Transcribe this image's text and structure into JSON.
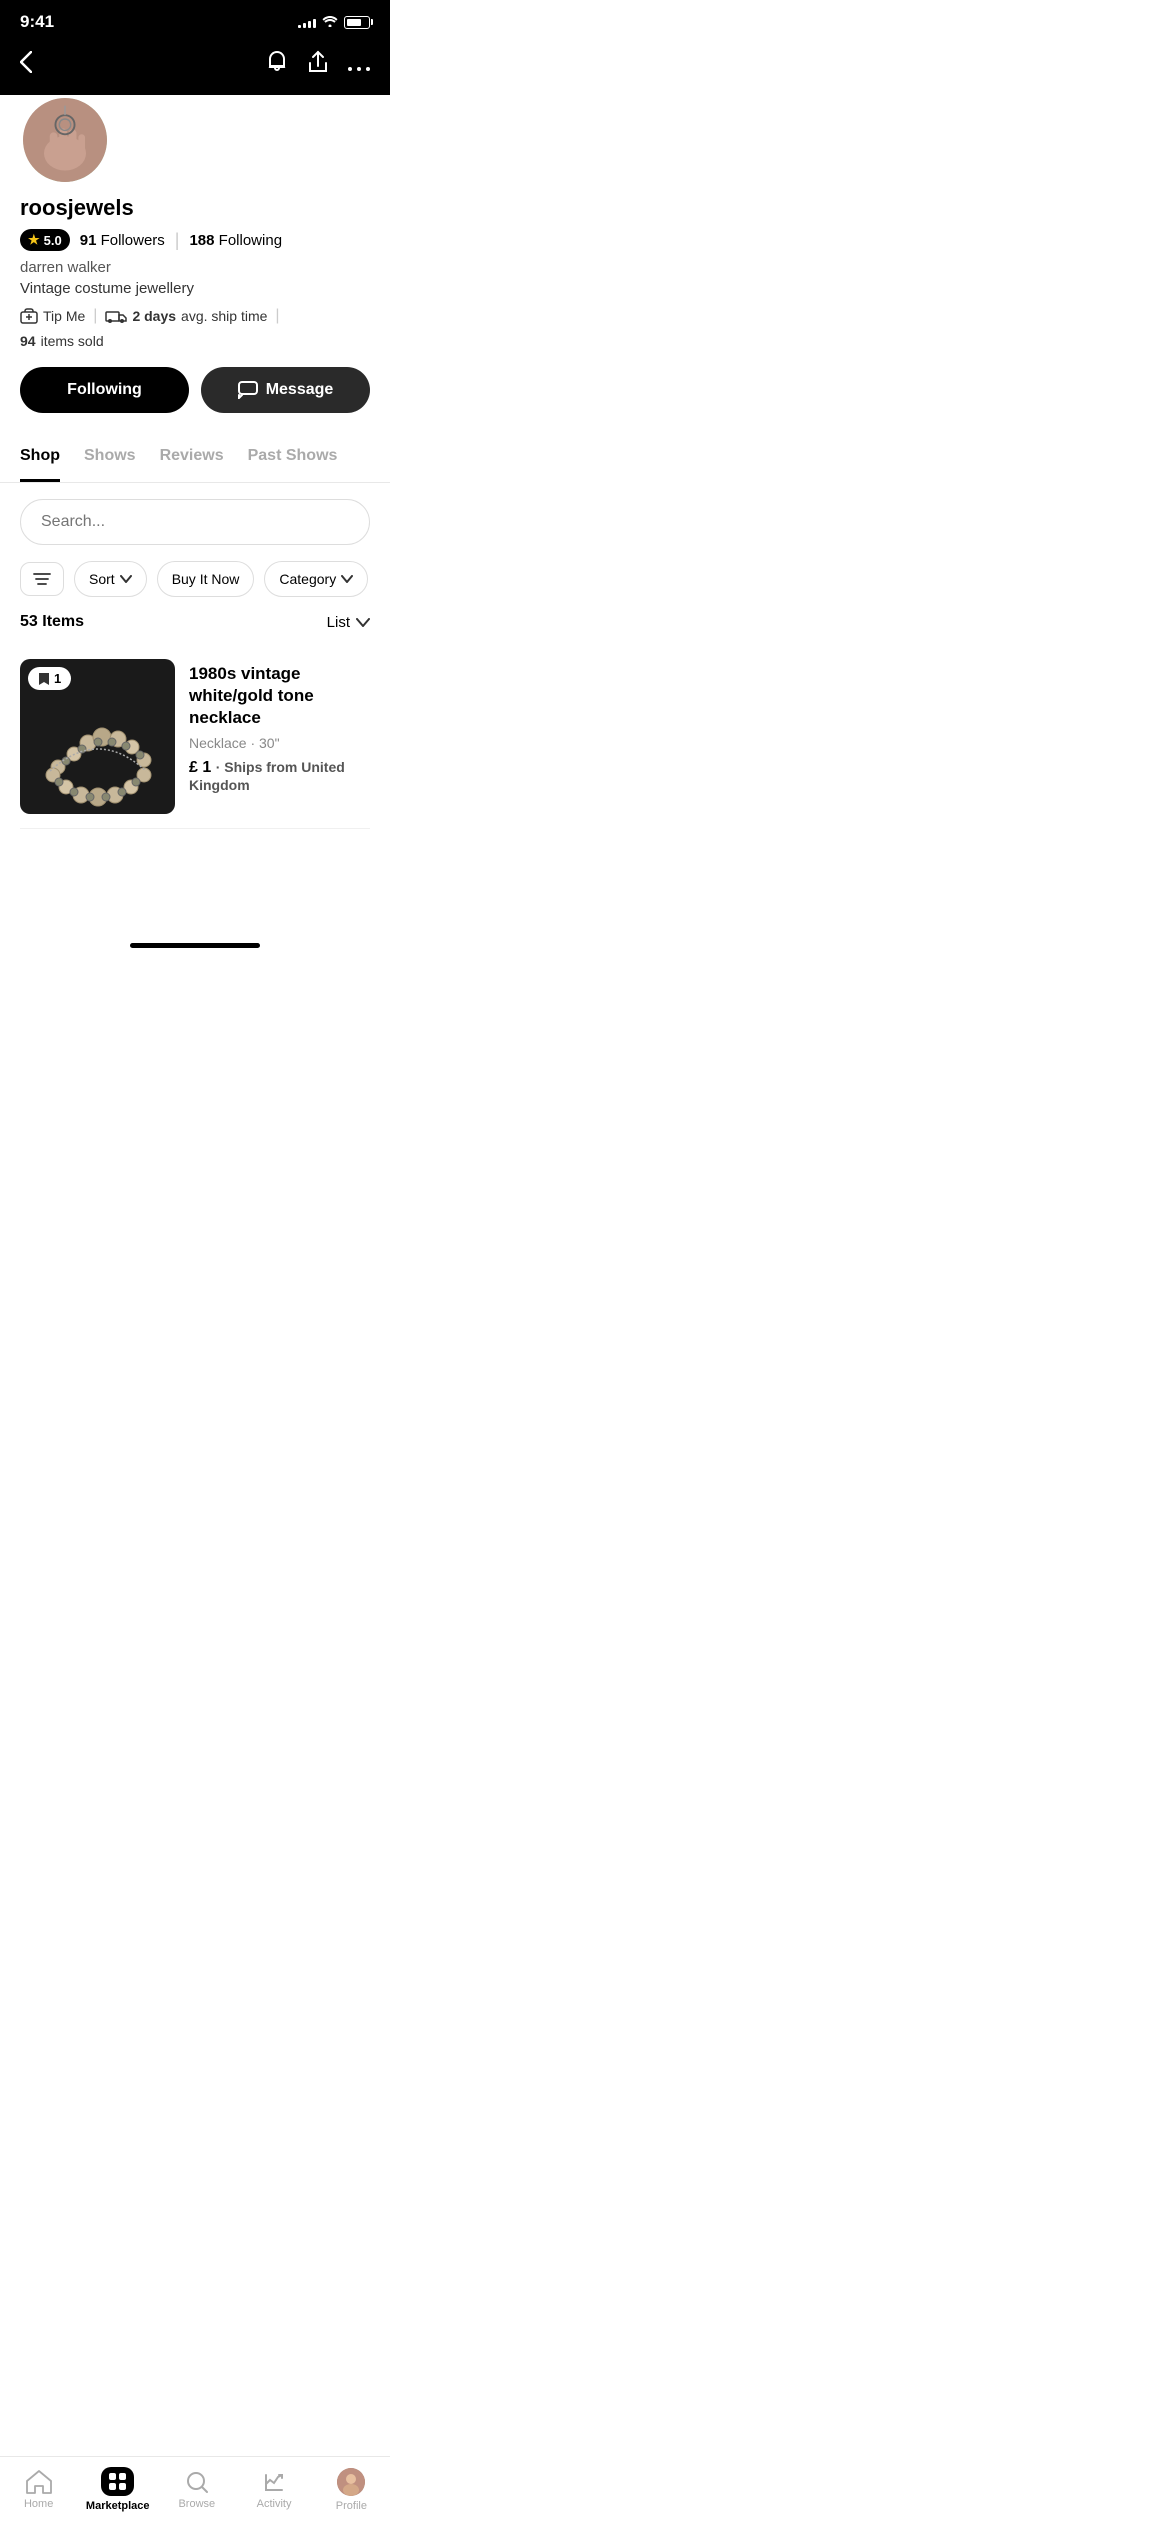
{
  "statusBar": {
    "time": "9:41",
    "signalBars": [
      3,
      5,
      7,
      9,
      11
    ],
    "batteryLevel": 70
  },
  "header": {
    "backLabel": "‹",
    "bellIcon": "🔔",
    "shareIcon": "⬆",
    "moreIcon": "···"
  },
  "profile": {
    "username": "roosjewels",
    "rating": "5.0",
    "followers": "91",
    "followersLabel": "Followers",
    "following": "188",
    "followingLabel": "Following",
    "displayName": "darren walker",
    "bio": "Vintage costume jewellery",
    "tipMeLabel": "Tip Me",
    "avgShipTime": "2 days",
    "avgShipLabel": "avg. ship time",
    "itemsSold": "94",
    "itemsSoldLabel": "items sold",
    "followingButtonLabel": "Following",
    "messageButtonLabel": "Message"
  },
  "tabs": {
    "items": [
      {
        "label": "Shop",
        "active": true
      },
      {
        "label": "Shows",
        "active": false
      },
      {
        "label": "Reviews",
        "active": false
      },
      {
        "label": "Past Shows",
        "active": false
      }
    ]
  },
  "shop": {
    "searchPlaceholder": "Search...",
    "filterIcon": "⚙",
    "sortLabel": "Sort",
    "buyItNowLabel": "Buy It Now",
    "categoryLabel": "Category",
    "itemsCount": "53 Items",
    "viewModeLabel": "List"
  },
  "products": [
    {
      "title": "1980s vintage white/gold tone necklace",
      "subtitle": "Necklace · 30\"",
      "price": "£ 1",
      "shipping": "Ships from United Kingdom",
      "bookmarkCount": "1"
    }
  ],
  "bottomNav": {
    "items": [
      {
        "label": "Home",
        "icon": "home",
        "active": false
      },
      {
        "label": "Marketplace",
        "icon": "marketplace",
        "active": true
      },
      {
        "label": "Browse",
        "icon": "browse",
        "active": false
      },
      {
        "label": "Activity",
        "icon": "activity",
        "active": false
      },
      {
        "label": "Profile",
        "icon": "profile",
        "active": false
      }
    ]
  }
}
